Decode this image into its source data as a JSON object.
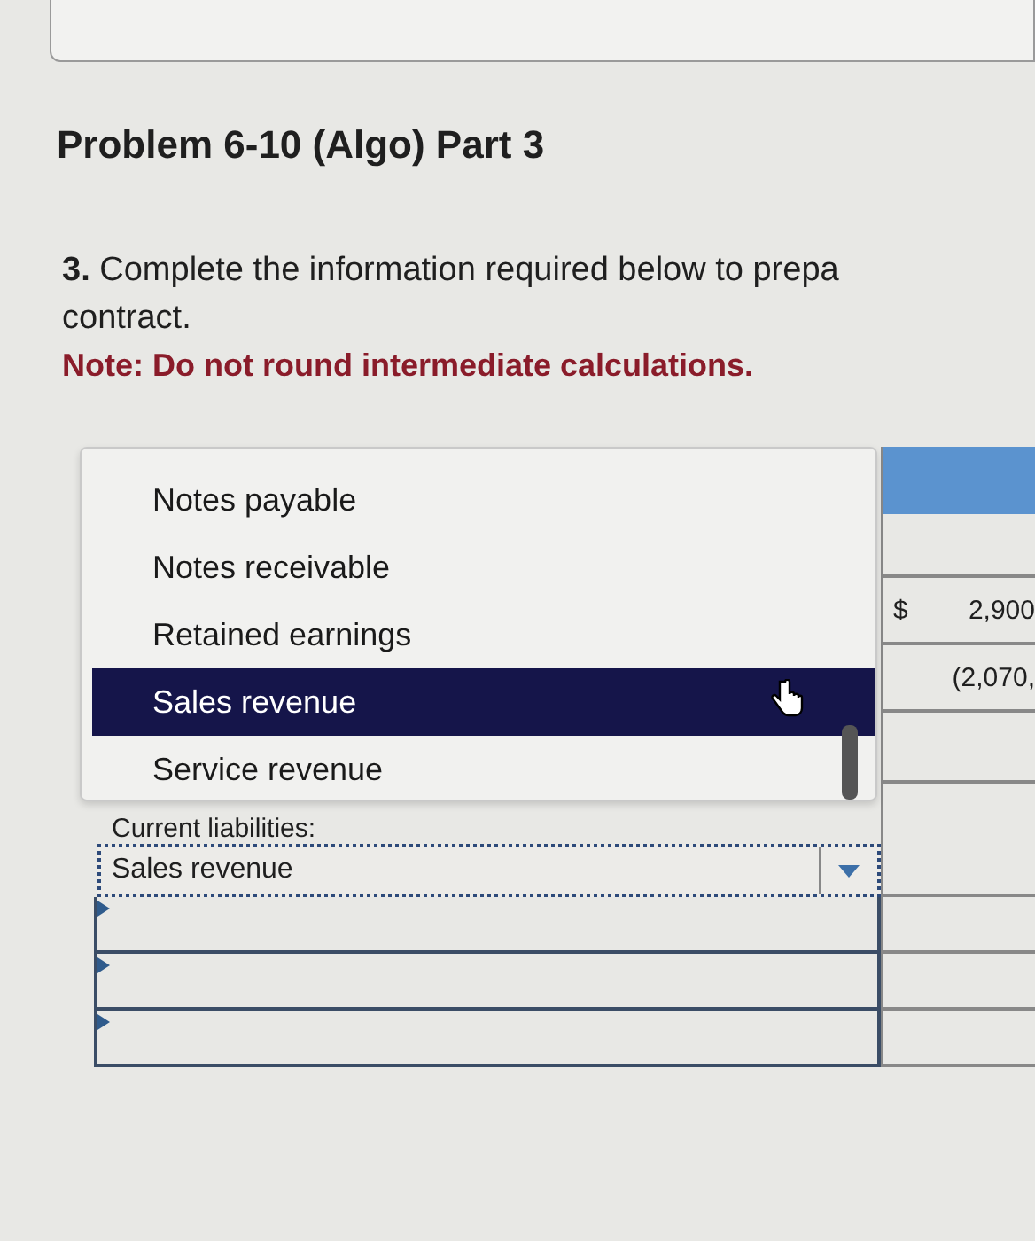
{
  "problem": {
    "title": "Problem 6-10 (Algo) Part 3",
    "instruction": "**3.** Complete the information required below to prepa",
    "instruction_continued": "contract.",
    "note": "Note: Do not round intermediate calculations."
  },
  "table": {
    "rows": [
      {
        "kind": "header"
      },
      {
        "kind": "blank"
      },
      {
        "kind": "amount",
        "currency": "$",
        "amount": "2,900"
      },
      {
        "kind": "amount",
        "amount": "(2,070,"
      },
      {
        "kind": "blank"
      },
      {
        "kind": "label",
        "label": "Current liabilities:"
      },
      {
        "kind": "select",
        "value": "Sales revenue"
      },
      {
        "kind": "input"
      },
      {
        "kind": "input"
      },
      {
        "kind": "input"
      }
    ]
  },
  "dropdown": {
    "options": [
      {
        "label": "Notes payable",
        "selected": false
      },
      {
        "label": "Notes receivable",
        "selected": false
      },
      {
        "label": "Retained earnings",
        "selected": false
      },
      {
        "label": "Sales revenue",
        "selected": true
      },
      {
        "label": "Service revenue",
        "selected": false
      }
    ]
  }
}
